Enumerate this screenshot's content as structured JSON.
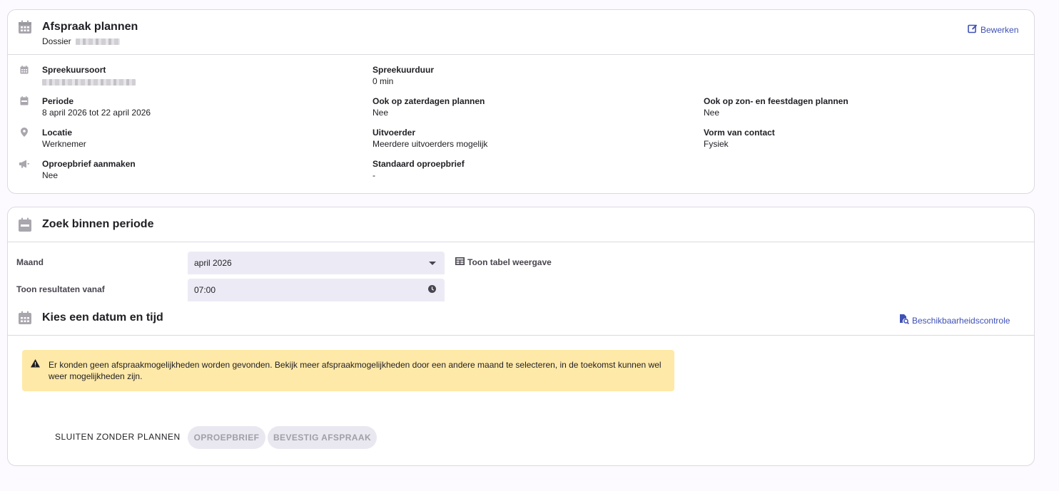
{
  "card1": {
    "title": "Afspraak plannen",
    "subtitle_label": "Dossier",
    "edit_label": "Bewerken",
    "fields": {
      "spreekuursoort_label": "Spreekuursoort",
      "spreekuurduur_label": "Spreekuurduur",
      "spreekuurduur_value": "0 min",
      "periode_label": "Periode",
      "periode_value": "8 april 2026 tot 22 april 2026",
      "zaterdag_label": "Ook op zaterdagen plannen",
      "zaterdag_value": "Nee",
      "zondag_label": "Ook op zon- en feestdagen plannen",
      "zondag_value": "Nee",
      "locatie_label": "Locatie",
      "locatie_value": "Werknemer",
      "uitvoerder_label": "Uitvoerder",
      "uitvoerder_value": "Meerdere uitvoerders mogelijk",
      "contact_label": "Vorm van contact",
      "contact_value": "Fysiek",
      "oproepbrief_label": "Oproepbrief aanmaken",
      "oproepbrief_value": "Nee",
      "standaard_label": "Standaard oproepbrief",
      "standaard_value": "-"
    }
  },
  "card2": {
    "title": "Zoek binnen periode",
    "maand_label": "Maand",
    "maand_value": "april 2026",
    "tabel_label": "Toon tabel weergave",
    "tijd_label": "Toon resultaten vanaf",
    "tijd_value": "07:00",
    "kies_title": "Kies een datum en tijd",
    "beschikbaarheid_label": "Beschikbaarheidscontrole",
    "alert_text": "Er konden geen afspraakmogelijkheden worden gevonden. Bekijk meer afspraakmogelijkheden door een andere maand te selecteren, in de toekomst kunnen wel weer mogelijkheden zijn.",
    "buttons": {
      "sluiten": "SLUITEN ZONDER PLANNEN",
      "oproepbrief": "OPROEPBRIEF",
      "bevestig": "BEVESTIG AFSPRAAK"
    }
  },
  "colors": {
    "accent": "#3f51b5",
    "alert_bg": "#ffe9a8",
    "input_bg": "#ecebf5",
    "icon_gray": "#9e9ba3"
  },
  "icons": [
    "calendar-icon",
    "edit-icon",
    "calendar-small-icon",
    "event-icon",
    "location-pin-icon",
    "megaphone-icon",
    "dropdown-arrow-icon",
    "table-icon",
    "clock-icon",
    "file-search-icon",
    "warning-icon"
  ]
}
